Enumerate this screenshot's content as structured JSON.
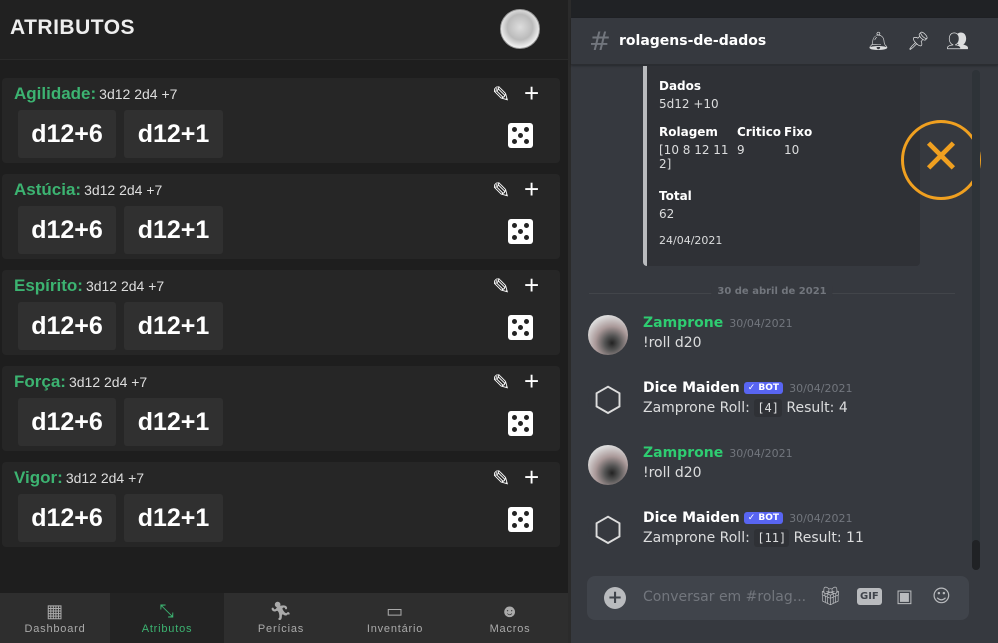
{
  "left": {
    "title": "ATRIBUTOS",
    "attributes": [
      {
        "name": "Agilidade:",
        "dice": "3d12 2d4 +7",
        "buttons": [
          "d12+6",
          "d12+1"
        ]
      },
      {
        "name": "Astúcia:",
        "dice": "3d12 2d4 +7",
        "buttons": [
          "d12+6",
          "d12+1"
        ]
      },
      {
        "name": "Espírito:",
        "dice": "3d12 2d4 +7",
        "buttons": [
          "d12+6",
          "d12+1"
        ]
      },
      {
        "name": "Força:",
        "dice": "3d12 2d4 +7",
        "buttons": [
          "d12+6",
          "d12+1"
        ]
      },
      {
        "name": "Vigor:",
        "dice": "3d12 2d4 +7",
        "buttons": [
          "d12+6",
          "d12+1"
        ]
      }
    ],
    "nav": [
      {
        "label": "Dashboard"
      },
      {
        "label": "Atributos"
      },
      {
        "label": "Perícias"
      },
      {
        "label": "Inventário"
      },
      {
        "label": "Macros"
      }
    ],
    "accent": "#3cb371"
  },
  "right": {
    "channel": "rolagens-de-dados",
    "embed": {
      "dados_label": "Dados",
      "dados": "5d12 +10",
      "rolagem_label": "Rolagem",
      "rolagem": "[10 8 12 11 2]",
      "critico_label": "Critico",
      "critico": "9",
      "fixo_label": "Fixo",
      "fixo": "10",
      "total_label": "Total",
      "total": "62",
      "date": "24/04/2021"
    },
    "separator": "30 de abril de 2021",
    "messages": [
      {
        "author": "Zamprone",
        "time": "30/04/2021",
        "text": "!roll d20"
      },
      {
        "author": "Dice Maiden",
        "badge": "✓ BOT",
        "time": "30/04/2021",
        "prefix": "Zamprone Roll:",
        "code": "[4]",
        "result": "Result: 4"
      },
      {
        "author": "Zamprone",
        "time": "30/04/2021",
        "text": "!roll d20"
      },
      {
        "author": "Dice Maiden",
        "badge": "✓ BOT",
        "time": "30/04/2021",
        "prefix": "Zamprone Roll:",
        "code": "[11]",
        "result": "Result: 11"
      }
    ],
    "input_placeholder": "Conversar em #rolag...",
    "gif": "GIF"
  }
}
